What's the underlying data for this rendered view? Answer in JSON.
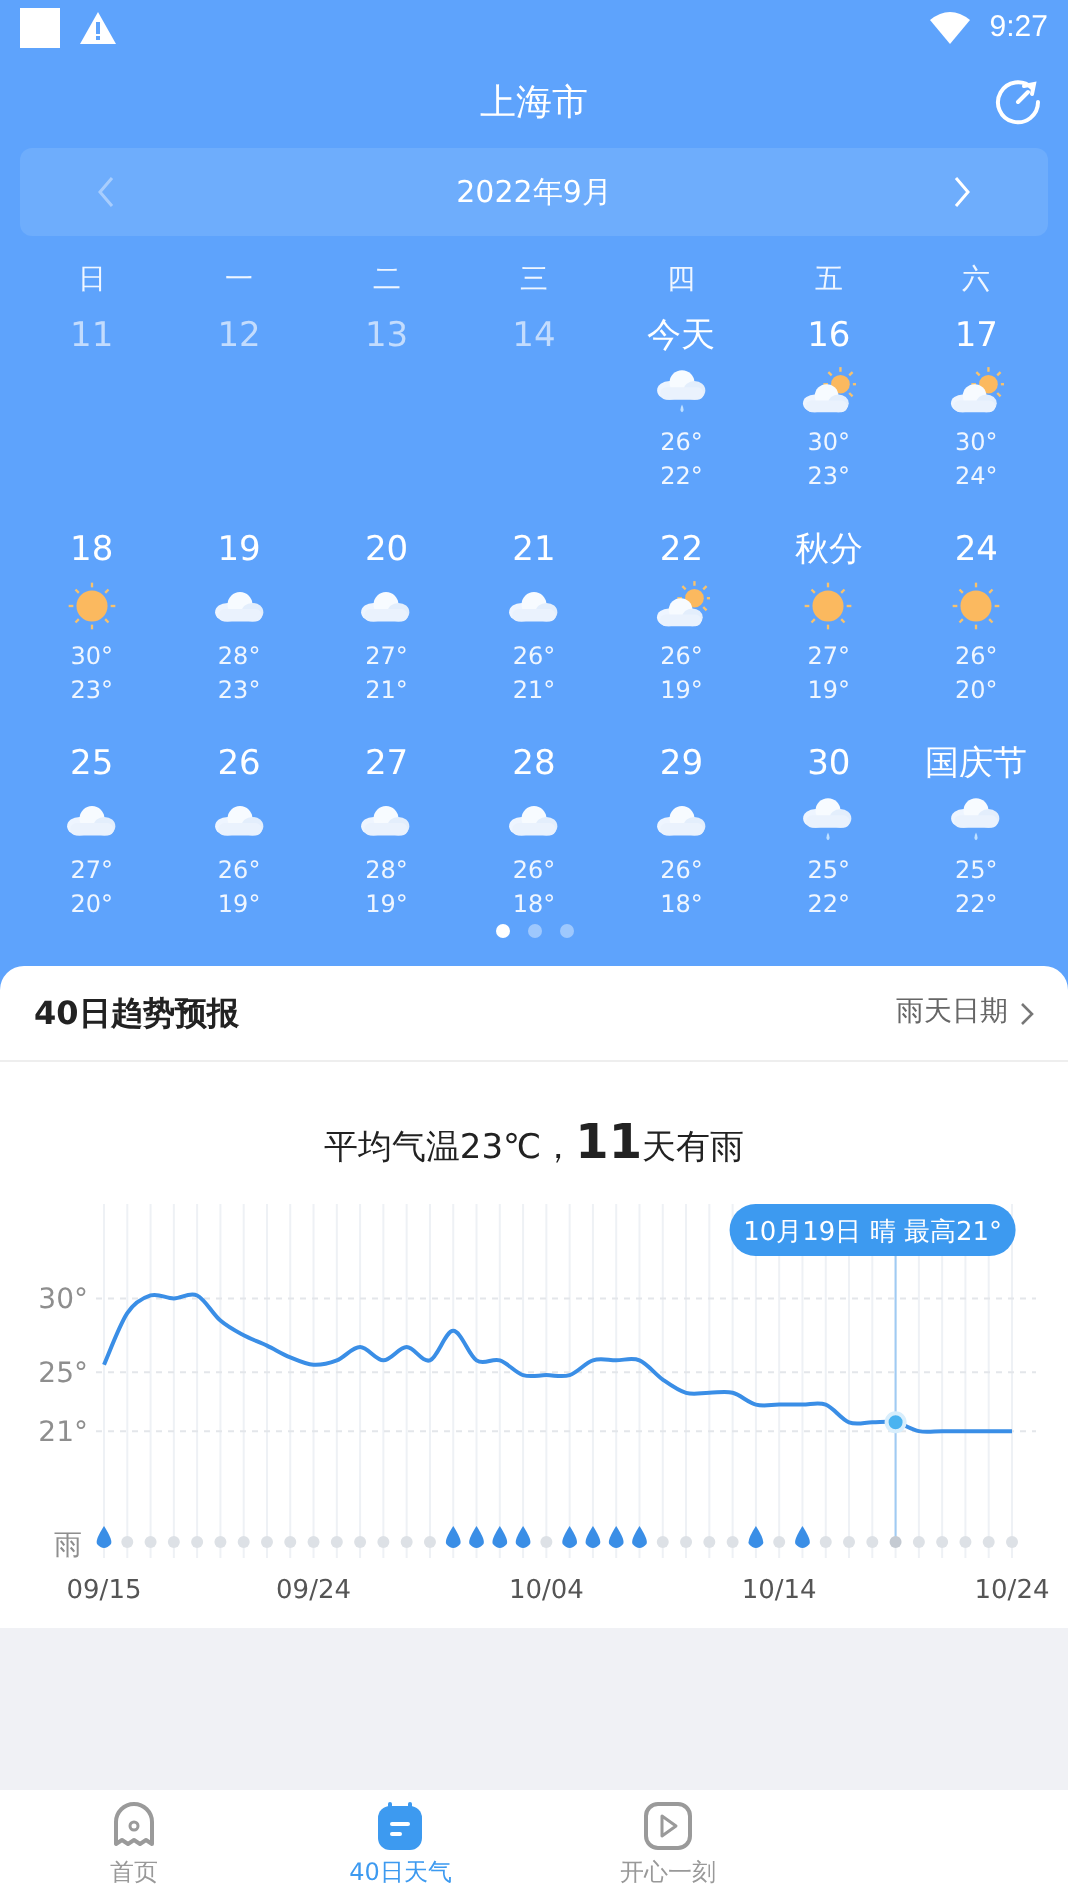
{
  "status_bar": {
    "time": "9:27"
  },
  "header": {
    "title": "上海市"
  },
  "month_nav": {
    "label": "2022年9月",
    "prev_disabled": true,
    "next_disabled": false
  },
  "weekdays": [
    "日",
    "一",
    "二",
    "三",
    "四",
    "五",
    "六"
  ],
  "weeks": [
    [
      {
        "label": "11",
        "past": true,
        "kind": "blank"
      },
      {
        "label": "12",
        "past": true,
        "kind": "blank"
      },
      {
        "label": "13",
        "past": true,
        "kind": "blank"
      },
      {
        "label": "14",
        "past": true,
        "kind": "blank"
      },
      {
        "label": "今天",
        "past": false,
        "kind": "rain",
        "high": "26°",
        "low": "22°"
      },
      {
        "label": "16",
        "past": false,
        "kind": "partly_cloudy",
        "high": "30°",
        "low": "23°"
      },
      {
        "label": "17",
        "past": false,
        "kind": "partly_cloudy",
        "high": "30°",
        "low": "24°"
      }
    ],
    [
      {
        "label": "18",
        "past": false,
        "kind": "sunny",
        "high": "30°",
        "low": "23°"
      },
      {
        "label": "19",
        "past": false,
        "kind": "cloudy",
        "high": "28°",
        "low": "23°"
      },
      {
        "label": "20",
        "past": false,
        "kind": "cloudy",
        "high": "27°",
        "low": "21°"
      },
      {
        "label": "21",
        "past": false,
        "kind": "cloudy",
        "high": "26°",
        "low": "21°"
      },
      {
        "label": "22",
        "past": false,
        "kind": "partly_cloudy",
        "high": "26°",
        "low": "19°"
      },
      {
        "label": "秋分",
        "past": false,
        "kind": "sunny",
        "high": "27°",
        "low": "19°"
      },
      {
        "label": "24",
        "past": false,
        "kind": "sunny",
        "high": "26°",
        "low": "20°"
      }
    ],
    [
      {
        "label": "25",
        "past": false,
        "kind": "cloudy",
        "high": "27°",
        "low": "20°"
      },
      {
        "label": "26",
        "past": false,
        "kind": "cloudy",
        "high": "26°",
        "low": "19°"
      },
      {
        "label": "27",
        "past": false,
        "kind": "cloudy",
        "high": "28°",
        "low": "19°"
      },
      {
        "label": "28",
        "past": false,
        "kind": "cloudy",
        "high": "26°",
        "low": "18°"
      },
      {
        "label": "29",
        "past": false,
        "kind": "cloudy",
        "high": "26°",
        "low": "18°"
      },
      {
        "label": "30",
        "past": false,
        "kind": "rain",
        "high": "25°",
        "low": "22°"
      },
      {
        "label": "国庆节",
        "past": false,
        "kind": "rain",
        "high": "25°",
        "low": "22°"
      }
    ]
  ],
  "pager": [
    {
      "selected": true
    },
    {
      "selected": false
    },
    {
      "selected": false
    }
  ],
  "trend": {
    "title": "40日趋势预报",
    "link": "雨天日期",
    "summary": "平均气温23℃，**11**天有雨",
    "chart_data": {
      "type": "line",
      "categories": [
        "09/15",
        null,
        null,
        null,
        null,
        null,
        null,
        null,
        null,
        "09/24",
        null,
        null,
        null,
        null,
        null,
        null,
        null,
        null,
        null,
        "10/04",
        null,
        null,
        null,
        null,
        null,
        null,
        null,
        null,
        null,
        "10/14",
        null,
        null,
        null,
        null,
        null,
        null,
        null,
        null,
        null,
        "10/24"
      ],
      "series": [
        {
          "color": "#3a8ee6",
          "values": [
            25.5,
            29,
            30.2,
            30,
            30.2,
            28.5,
            27.5,
            26.8,
            26,
            25.5,
            25.8,
            26.7,
            25.8,
            26.7,
            25.8,
            27.8,
            25.8,
            25.8,
            24.8,
            24.8,
            24.8,
            25.8,
            25.8,
            25.8,
            24.5,
            23.6,
            23.6,
            23.6,
            22.8,
            22.8,
            22.8,
            22.8,
            21.6,
            21.6,
            21.6,
            21,
            21,
            21,
            21,
            21
          ]
        }
      ],
      "ylim": [
        12.4,
        36.4
      ],
      "grid": true,
      "yticks": [
        {
          "value": 30,
          "label": "30°"
        },
        {
          "value": 25,
          "label": "25°"
        },
        {
          "value": 21,
          "label": "21°"
        }
      ],
      "annotations": [
        "10月19日 晴 最高21°"
      ]
    },
    "rain_row": {
      "label": "雨",
      "days": [
        {
          "rain": true,
          "selected": false
        },
        {
          "rain": false,
          "selected": false
        },
        {
          "rain": false,
          "selected": false
        },
        {
          "rain": false,
          "selected": false
        },
        {
          "rain": false,
          "selected": false
        },
        {
          "rain": false,
          "selected": false
        },
        {
          "rain": false,
          "selected": false
        },
        {
          "rain": false,
          "selected": false
        },
        {
          "rain": false,
          "selected": false
        },
        {
          "rain": false,
          "selected": false
        },
        {
          "rain": false,
          "selected": false
        },
        {
          "rain": false,
          "selected": false
        },
        {
          "rain": false,
          "selected": false
        },
        {
          "rain": false,
          "selected": false
        },
        {
          "rain": false,
          "selected": false
        },
        {
          "rain": true,
          "selected": false
        },
        {
          "rain": true,
          "selected": false
        },
        {
          "rain": true,
          "selected": false
        },
        {
          "rain": true,
          "selected": false
        },
        {
          "rain": false,
          "selected": false
        },
        {
          "rain": true,
          "selected": false
        },
        {
          "rain": true,
          "selected": false
        },
        {
          "rain": true,
          "selected": false
        },
        {
          "rain": true,
          "selected": false
        },
        {
          "rain": false,
          "selected": false
        },
        {
          "rain": false,
          "selected": false
        },
        {
          "rain": false,
          "selected": false
        },
        {
          "rain": false,
          "selected": false
        },
        {
          "rain": true,
          "selected": false
        },
        {
          "rain": false,
          "selected": false
        },
        {
          "rain": true,
          "selected": false
        },
        {
          "rain": false,
          "selected": false
        },
        {
          "rain": false,
          "selected": false
        },
        {
          "rain": false,
          "selected": false
        },
        {
          "rain": false,
          "selected": true
        },
        {
          "rain": false,
          "selected": false
        },
        {
          "rain": false,
          "selected": false
        },
        {
          "rain": false,
          "selected": false
        },
        {
          "rain": false,
          "selected": false
        },
        {
          "rain": false,
          "selected": false
        }
      ]
    }
  },
  "bottom_nav": [
    {
      "label": "首页",
      "kind": "ghost",
      "selected": false
    },
    {
      "label": "40日天气",
      "kind": "calendar",
      "selected": true
    },
    {
      "label": "开心一刻",
      "kind": "play",
      "selected": false
    }
  ]
}
